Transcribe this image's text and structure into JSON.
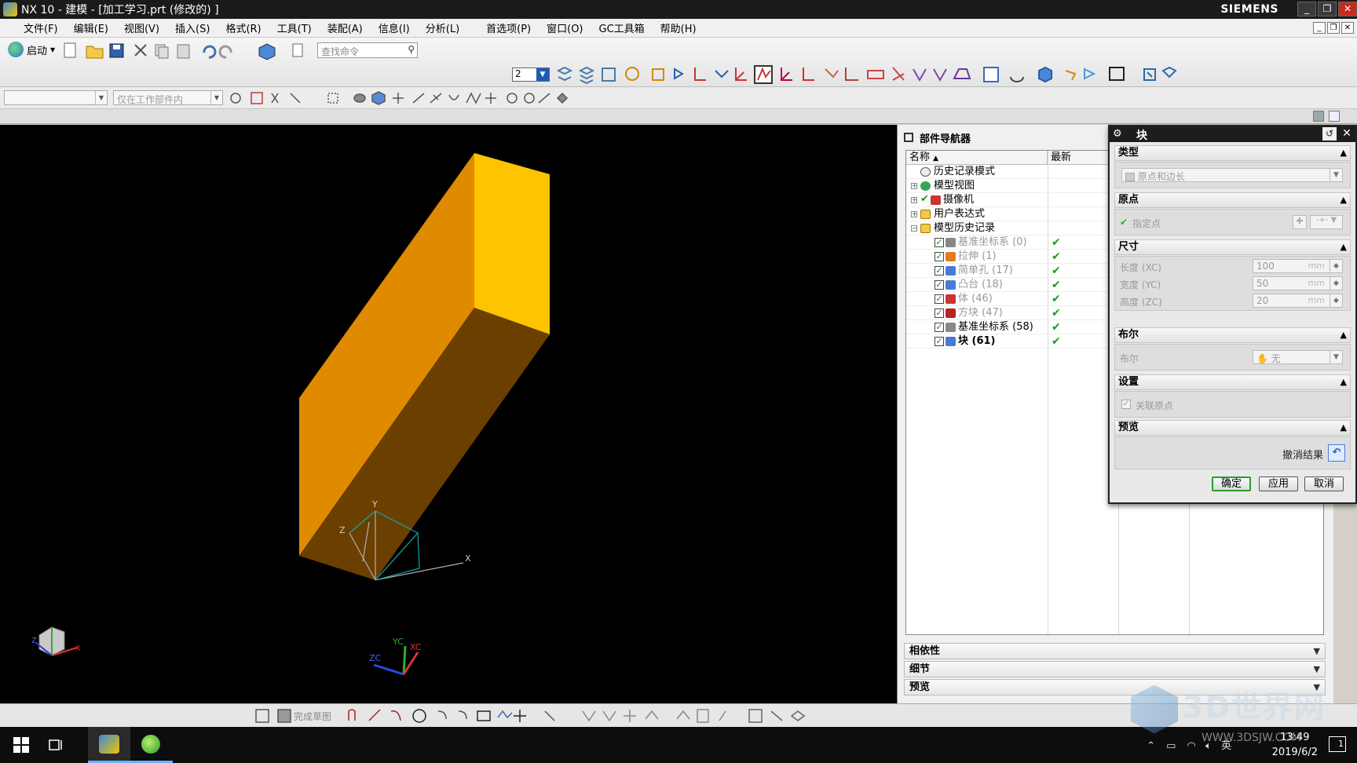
{
  "window": {
    "title": "NX 10 - 建模 - [加工学习.prt  (修改的) ]",
    "brand": "SIEMENS"
  },
  "menu": [
    "文件(F)",
    "编辑(E)",
    "视图(V)",
    "插入(S)",
    "格式(R)",
    "工具(T)",
    "装配(A)",
    "信息(I)",
    "分析(L)",
    "首选项(P)",
    "窗口(O)",
    "GC工具箱",
    "帮助(H)"
  ],
  "toolbar": {
    "start_label": "启动",
    "search_placeholder": "查找命令",
    "layer_value": "2",
    "filter_combo": "",
    "scope_combo": "仅在工作部件内"
  },
  "viewport": {
    "background": "#000000",
    "block_colors": {
      "front": "#e08a00",
      "top": "#ffc400",
      "side": "#6b3f00"
    },
    "axis_labels": {
      "x": "X",
      "y": "Y",
      "z": "Z",
      "xc": "XC",
      "yc": "YC",
      "zc": "ZC"
    }
  },
  "navigator": {
    "title": "部件导航器",
    "col_name": "名称",
    "col_latest": "最新",
    "rows": [
      {
        "label": "历史记录模式",
        "style": "normal",
        "icon": "history-icon"
      },
      {
        "label": "模型视图",
        "style": "normal",
        "icon": "model-view-icon"
      },
      {
        "label": "摄像机",
        "style": "normal",
        "icon": "camera-icon"
      },
      {
        "label": "用户表达式",
        "style": "normal",
        "icon": "folder-icon"
      },
      {
        "label": "模型历史记录",
        "style": "normal",
        "icon": "folder-open-icon"
      },
      {
        "label": "基准坐标系 (0)",
        "style": "gray",
        "latest": "✔",
        "icon": "datum-csys-icon"
      },
      {
        "label": "拉伸 (1)",
        "style": "gray",
        "latest": "✔",
        "icon": "extrude-icon"
      },
      {
        "label": "简单孔 (17)",
        "style": "gray",
        "latest": "✔",
        "icon": "hole-icon"
      },
      {
        "label": "凸台 (18)",
        "style": "gray",
        "latest": "✔",
        "icon": "boss-icon"
      },
      {
        "label": "体 (46)",
        "style": "gray",
        "latest": "✔",
        "icon": "body-icon"
      },
      {
        "label": "方块 (47)",
        "style": "gray",
        "latest": "✔",
        "icon": "block-icon"
      },
      {
        "label": "基准坐标系 (58)",
        "style": "normal",
        "latest": "✔",
        "icon": "datum-csys-icon"
      },
      {
        "label": "块 (61)",
        "style": "bold",
        "latest": "✔",
        "icon": "block-icon"
      }
    ],
    "sections": [
      "相依性",
      "细节",
      "预览"
    ]
  },
  "dialog": {
    "title": "块",
    "sections": {
      "type": {
        "label": "类型",
        "value": "原点和边长"
      },
      "origin": {
        "label": "原点",
        "point_label": "指定点"
      },
      "dims": {
        "label": "尺寸",
        "length_label": "长度 (XC)",
        "length_value": "100",
        "width_label": "宽度 (YC)",
        "width_value": "50",
        "height_label": "高度 (ZC)",
        "height_value": "20",
        "unit": "mm"
      },
      "bool": {
        "label": "布尔",
        "field_label": "布尔",
        "value": "无"
      },
      "settings": {
        "label": "设置",
        "assoc_label": "关联原点"
      },
      "preview": {
        "label": "预览",
        "undo_label": "撤消结果"
      }
    },
    "buttons": {
      "ok": "确定",
      "apply": "应用",
      "cancel": "取消"
    }
  },
  "sketch_toolbar": {
    "finish_label": "完成草图"
  },
  "taskbar": {
    "time": "13:49",
    "date": "2019/6/2",
    "ime": "英",
    "notification_count": "1"
  },
  "watermark": {
    "main": "3D世界网",
    "sub": "WWW.3DSJW.COM"
  }
}
